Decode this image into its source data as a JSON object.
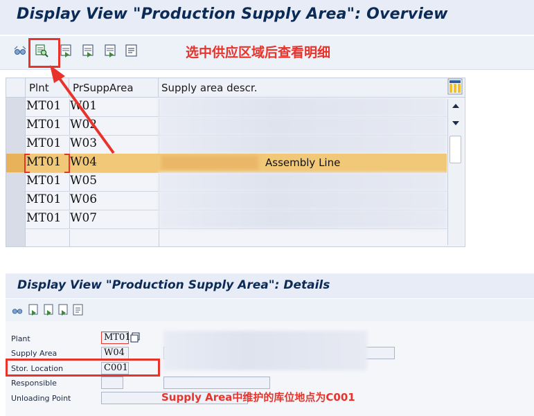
{
  "overview": {
    "title": "Display View \"Production Supply Area\": Overview",
    "annotation": "选中供应区域后查看明细",
    "columns": [
      "Plnt",
      "PrSuppArea",
      "Supply area descr."
    ],
    "rows": [
      {
        "plant": "MT01",
        "area": "W01",
        "descr": ""
      },
      {
        "plant": "MT01",
        "area": "W02",
        "descr": ""
      },
      {
        "plant": "MT01",
        "area": "W03",
        "descr": ""
      },
      {
        "plant": "MT01",
        "area": "W04",
        "descr": "Assembly Line"
      },
      {
        "plant": "MT01",
        "area": "W05",
        "descr": ""
      },
      {
        "plant": "MT01",
        "area": "W06",
        "descr": ""
      },
      {
        "plant": "MT01",
        "area": "W07",
        "descr": ""
      }
    ],
    "selected_row": 3
  },
  "details": {
    "title": "Display View \"Production Supply Area\": Details",
    "fields": {
      "plant_label": "Plant",
      "plant_value": "MT01",
      "supply_area_label": "Supply Area",
      "supply_area_value": "W04",
      "stor_location_label": "Stor. Location",
      "stor_location_value": "C001",
      "responsible_label": "Responsible",
      "unloading_point_label": "Unloading Point"
    },
    "annotation": "Supply Area中维护的库位地点为C001"
  },
  "colors": {
    "title_bg": "#e7ecf6",
    "highlight_row": "#f0c878",
    "annotation_red": "#e8332b"
  },
  "icons": [
    "glasses-icon",
    "details-magnifier-icon",
    "first-entry-icon",
    "prev-entry-icon",
    "next-entry-icon",
    "text-icon",
    "column-settings-icon"
  ]
}
